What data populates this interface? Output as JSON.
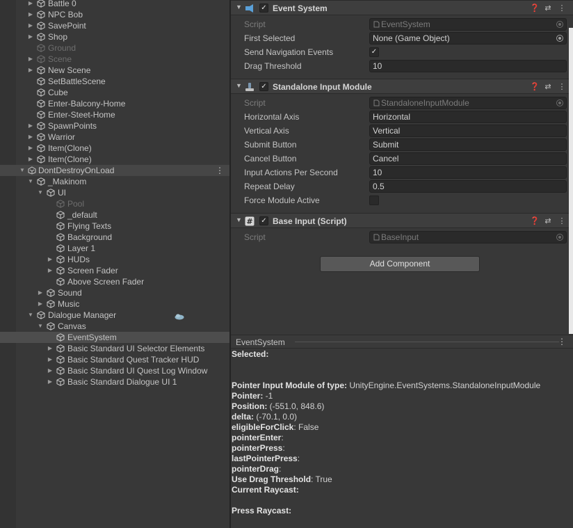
{
  "hierarchy": {
    "rows": [
      {
        "label": "Battle 0",
        "indent": 0,
        "arrow": "right",
        "state": "normal"
      },
      {
        "label": "NPC Bob",
        "indent": 0,
        "arrow": "right",
        "state": "normal"
      },
      {
        "label": "SavePoint",
        "indent": 0,
        "arrow": "right",
        "state": "normal"
      },
      {
        "label": "Shop",
        "indent": 0,
        "arrow": "right",
        "state": "normal"
      },
      {
        "label": "Ground",
        "indent": 0,
        "arrow": "none",
        "state": "disabled"
      },
      {
        "label": "Scene",
        "indent": 0,
        "arrow": "right",
        "state": "disabled"
      },
      {
        "label": "New Scene",
        "indent": 0,
        "arrow": "right",
        "state": "normal"
      },
      {
        "label": "SetBattleScene",
        "indent": 0,
        "arrow": "none",
        "state": "normal"
      },
      {
        "label": "Cube",
        "indent": 0,
        "arrow": "none",
        "state": "normal"
      },
      {
        "label": "Enter-Balcony-Home",
        "indent": 0,
        "arrow": "none",
        "state": "normal"
      },
      {
        "label": "Enter-Steet-Home",
        "indent": 0,
        "arrow": "none",
        "state": "normal"
      },
      {
        "label": "SpawnPoints",
        "indent": 0,
        "arrow": "right",
        "state": "normal"
      },
      {
        "label": "Warrior",
        "indent": 0,
        "arrow": "right",
        "state": "normal"
      },
      {
        "label": "Item(Clone)",
        "indent": 0,
        "arrow": "right",
        "state": "normal"
      },
      {
        "label": "Item(Clone)",
        "indent": 0,
        "arrow": "right",
        "state": "normal"
      },
      {
        "label": "DontDestroyOnLoad",
        "indent": -1,
        "arrow": "down",
        "state": "scene"
      },
      {
        "label": "_Makinom",
        "indent": 0,
        "arrow": "down",
        "state": "normal"
      },
      {
        "label": "UI",
        "indent": 1,
        "arrow": "down",
        "state": "normal"
      },
      {
        "label": "Pool",
        "indent": 2,
        "arrow": "none",
        "state": "disabled"
      },
      {
        "label": "_default",
        "indent": 2,
        "arrow": "none",
        "state": "normal"
      },
      {
        "label": "Flying Texts",
        "indent": 2,
        "arrow": "none",
        "state": "normal"
      },
      {
        "label": "Background",
        "indent": 2,
        "arrow": "none",
        "state": "normal"
      },
      {
        "label": "Layer 1",
        "indent": 2,
        "arrow": "none",
        "state": "normal"
      },
      {
        "label": "HUDs",
        "indent": 2,
        "arrow": "right",
        "state": "normal"
      },
      {
        "label": "Screen Fader",
        "indent": 2,
        "arrow": "right",
        "state": "normal"
      },
      {
        "label": "Above Screen Fader",
        "indent": 2,
        "arrow": "none",
        "state": "normal"
      },
      {
        "label": "Sound",
        "indent": 1,
        "arrow": "right",
        "state": "normal"
      },
      {
        "label": "Music",
        "indent": 1,
        "arrow": "right",
        "state": "normal"
      },
      {
        "label": "Dialogue Manager",
        "indent": 0,
        "arrow": "down",
        "state": "normal",
        "cloud": true
      },
      {
        "label": "Canvas",
        "indent": 1,
        "arrow": "down",
        "state": "normal"
      },
      {
        "label": "EventSystem",
        "indent": 2,
        "arrow": "none",
        "state": "selected"
      },
      {
        "label": "Basic Standard UI Selector Elements",
        "indent": 2,
        "arrow": "right",
        "state": "normal"
      },
      {
        "label": "Basic Standard Quest Tracker HUD",
        "indent": 2,
        "arrow": "right",
        "state": "normal"
      },
      {
        "label": "Basic Standard UI Quest Log Window",
        "indent": 2,
        "arrow": "right",
        "state": "normal"
      },
      {
        "label": "Basic Standard Dialogue UI 1",
        "indent": 2,
        "arrow": "right",
        "state": "normal"
      }
    ]
  },
  "inspector": {
    "components": [
      {
        "title": "Event System",
        "icon": "event-system-icon",
        "enabled": true,
        "props": [
          {
            "label": "Script",
            "value": "EventSystem",
            "kind": "script"
          },
          {
            "label": "First Selected",
            "value": "None (Game Object)",
            "kind": "object"
          },
          {
            "label": "Send Navigation Events",
            "value": "✓",
            "kind": "toggle"
          },
          {
            "label": "Drag Threshold",
            "value": "10",
            "kind": "text"
          }
        ]
      },
      {
        "title": "Standalone Input Module",
        "icon": "input-module-icon",
        "enabled": true,
        "props": [
          {
            "label": "Script",
            "value": "StandaloneInputModule",
            "kind": "script"
          },
          {
            "label": "Horizontal Axis",
            "value": "Horizontal",
            "kind": "text"
          },
          {
            "label": "Vertical Axis",
            "value": "Vertical",
            "kind": "text"
          },
          {
            "label": "Submit Button",
            "value": "Submit",
            "kind": "text"
          },
          {
            "label": "Cancel Button",
            "value": "Cancel",
            "kind": "text"
          },
          {
            "label": "Input Actions Per Second",
            "value": "10",
            "kind": "text"
          },
          {
            "label": "Repeat Delay",
            "value": "0.5",
            "kind": "text"
          },
          {
            "label": "Force Module Active",
            "value": "",
            "kind": "toggle"
          }
        ]
      },
      {
        "title": "Base Input (Script)",
        "icon": "script-hash-icon",
        "enabled": true,
        "props": [
          {
            "label": "Script",
            "value": "BaseInput",
            "kind": "script"
          }
        ]
      }
    ],
    "add_component": "Add Component",
    "header_icons": [
      "help-icon",
      "preset-icon",
      "kebab-menu-icon"
    ]
  },
  "preview": {
    "title": "EventSystem",
    "lines": [
      {
        "k": "Selected:",
        "v": ""
      },
      {
        "k": "",
        "v": ""
      },
      {
        "k": "",
        "v": ""
      },
      {
        "k": "Pointer Input Module of type:",
        "v": " UnityEngine.EventSystems.StandaloneInputModule"
      },
      {
        "k": "Pointer:",
        "v": " -1"
      },
      {
        "k": "Position:",
        "v": " (-551.0, 848.6)"
      },
      {
        "k": "delta:",
        "v": " (-70.1, 0.0)"
      },
      {
        "k": "eligibleForClick",
        "v": ": False"
      },
      {
        "k": "pointerEnter",
        "v": ":"
      },
      {
        "k": "pointerPress",
        "v": ":"
      },
      {
        "k": "lastPointerPress",
        "v": ":"
      },
      {
        "k": "pointerDrag",
        "v": ":"
      },
      {
        "k": "Use Drag Threshold",
        "v": ": True"
      },
      {
        "k": "Current Raycast:",
        "v": ""
      },
      {
        "k": "",
        "v": ""
      },
      {
        "k": "Press Raycast:",
        "v": ""
      }
    ]
  },
  "colors": {
    "panel": "#383838",
    "selected_row": "#4d4d4d",
    "field_bg": "#2a2a2a",
    "header_bg": "#3e3e3e"
  }
}
